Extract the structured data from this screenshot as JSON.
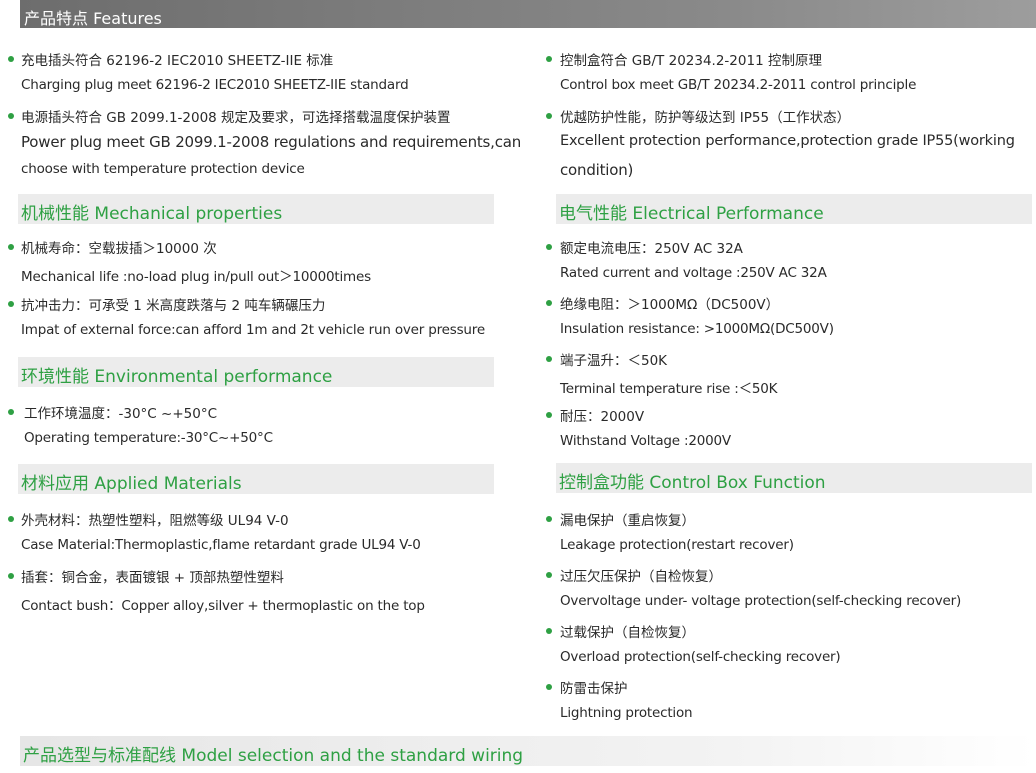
{
  "top_header": "产品特点 Features",
  "left": {
    "features": [
      {
        "zh": "充电插头符合 62196-2 IEC2010  SHEETZ-IIE 标准",
        "en": "Charging plug meet 62196-2 IEC2010  SHEETZ-IIE  standard"
      },
      {
        "zh": "电源插头符合 GB 2099.1-2008 规定及要求，可选择搭载温度保护装置",
        "en1": "Power plug meet GB 2099.1-2008 regulations and requirements,can",
        "en2": "choose with temperature protection device"
      }
    ],
    "mechanical": {
      "heading": "机械性能 Mechanical properties",
      "items": [
        {
          "zh": "机械寿命：空载拔插＞10000 次",
          "en": "Mechanical life :no-load plug in/pull out＞10000times"
        },
        {
          "zh": "抗冲击力：可承受 1 米高度跌落与 2 吨车辆碾压力",
          "en": "Impat of external force:can afford 1m and 2t vehicle run over pressure"
        }
      ]
    },
    "environmental": {
      "heading": "环境性能 Environmental performance",
      "items": [
        {
          "zh": "工作环境温度：-30°C ~+50°C",
          "en": "Operating temperature:-30°C~+50°C"
        }
      ]
    },
    "materials": {
      "heading": "材料应用 Applied Materials",
      "items": [
        {
          "zh": "外壳材料：热塑性塑料，阻燃等级 UL94 V-0",
          "en": "Case Material:Thermoplastic,flame retardant grade UL94 V-0"
        },
        {
          "zh": "插套：铜合金，表面镀银 + 顶部热塑性塑料",
          "en": "Contact bush：Copper alloy,silver + thermoplastic on the top"
        }
      ]
    }
  },
  "right": {
    "features": [
      {
        "zh": "控制盒符合 GB/T 20234.2-2011 控制原理",
        "en": "Control box meet GB/T 20234.2-2011 control principle"
      },
      {
        "zh": "优越防护性能，防护等级达到 IP55（工作状态）",
        "en1": "Excellent protection performance,protection grade IP55(working",
        "en2": "condition)"
      }
    ],
    "electrical": {
      "heading": "电气性能 Electrical Performance",
      "items": [
        {
          "zh": "额定电流电压：250V AC 32A",
          "en": "Rated current and voltage :250V AC 32A"
        },
        {
          "zh": "绝缘电阻：＞1000MΩ（DC500V）",
          "en": "Insulation resistance: >1000MΩ(DC500V)"
        },
        {
          "zh": "端子温升：＜50K",
          "en": "Terminal temperature rise :＜50K"
        },
        {
          "zh": "耐压：2000V",
          "en": "Withstand Voltage :2000V"
        }
      ]
    },
    "control": {
      "heading": "控制盒功能 Control Box Function",
      "items": [
        {
          "zh": "漏电保护（重启恢复）",
          "en": "Leakage protection(restart recover)"
        },
        {
          "zh": "过压欠压保护（自检恢复）",
          "en": "Overvoltage under- voltage protection(self-checking recover)"
        },
        {
          "zh": "过载保护（自检恢复）",
          "en": "Overload protection(self-checking recover)"
        },
        {
          "zh": "防雷击保护",
          "en": "Lightning protection"
        }
      ]
    }
  },
  "bottom_header": "产品选型与标准配线 Model selection and the standard wiring",
  "colors": {
    "accent_green": "#2ea043",
    "header_gray": "#7a7a7a",
    "section_bg": "#ececec"
  }
}
